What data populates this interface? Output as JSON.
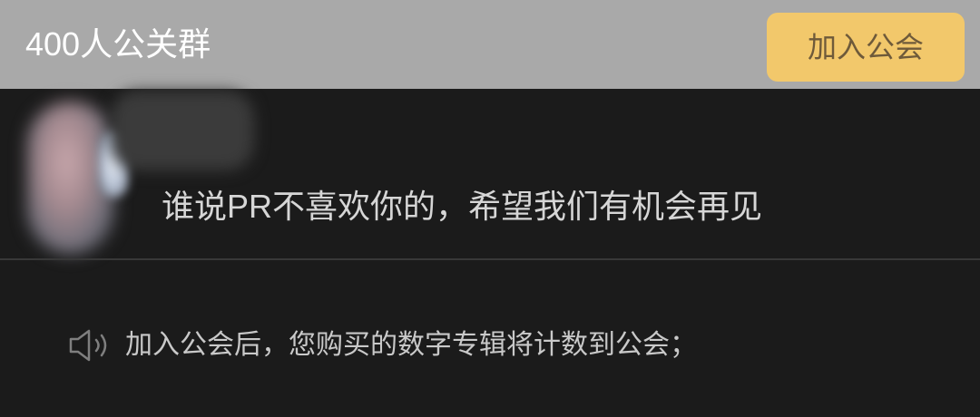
{
  "header": {
    "title": "400人公关群",
    "join_button_label": "加入公会"
  },
  "message": {
    "text": "谁说PR不喜欢你的，希望我们有机会再见"
  },
  "notice": {
    "icon": "speaker-icon",
    "text": "加入公会后，您购买的数字专辑将计数到公会；"
  },
  "colors": {
    "header_background": "#a9a9a9",
    "join_button_background": "#f2c86b",
    "join_button_text": "#6e5a3a",
    "page_background": "#1b1b1b",
    "divider": "#383838"
  }
}
